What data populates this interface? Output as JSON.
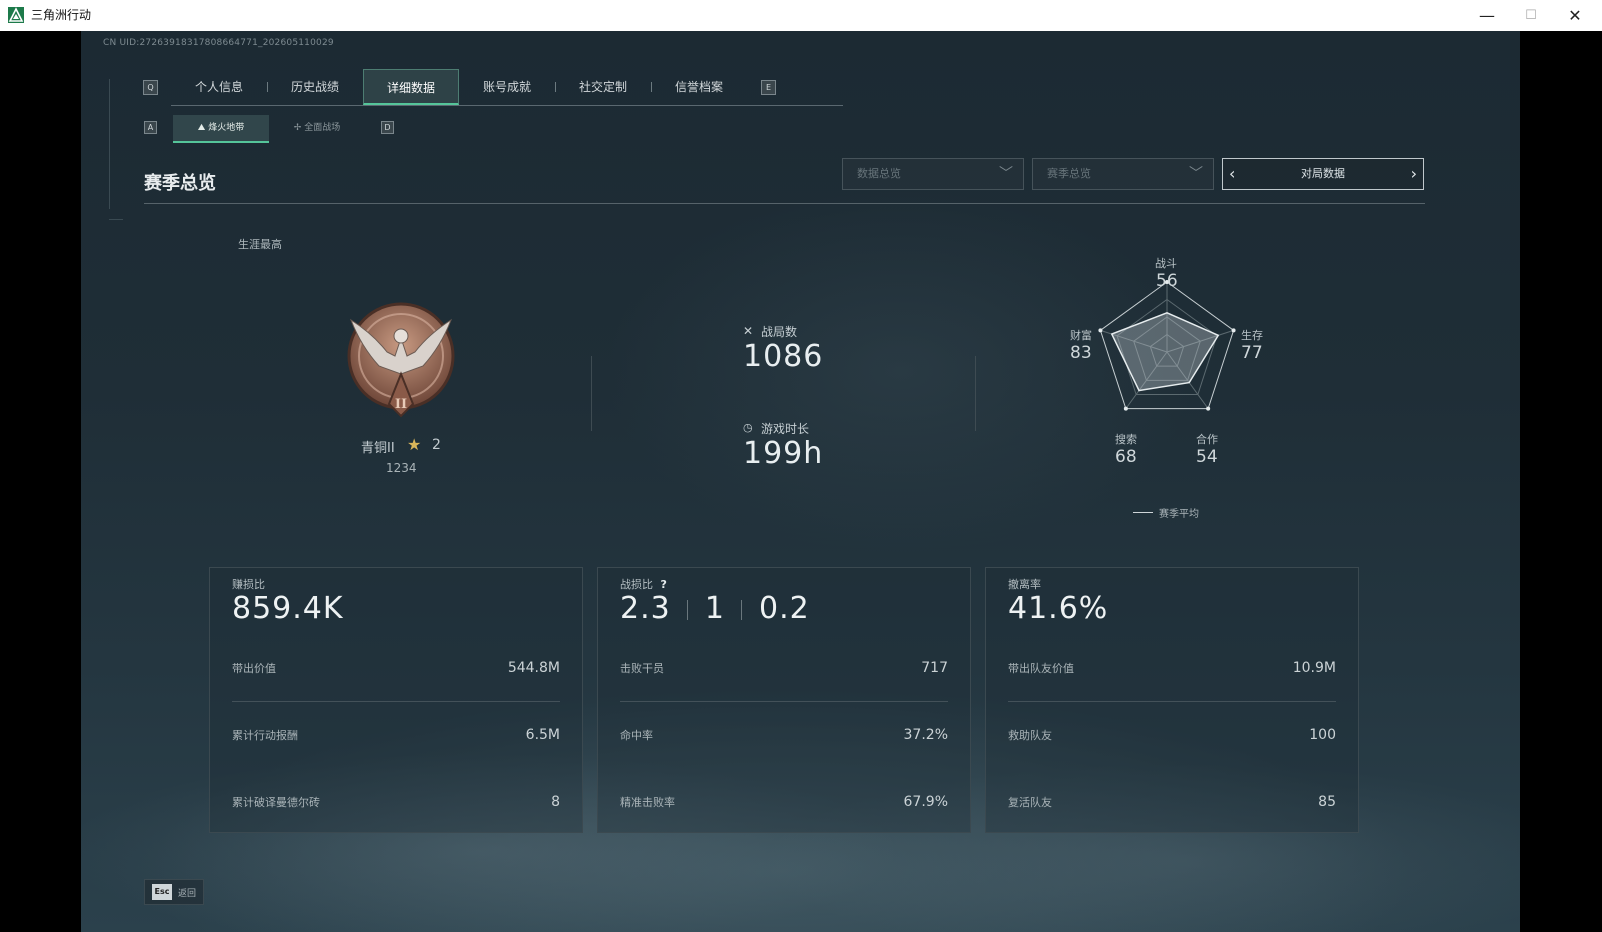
{
  "window": {
    "title": "三角洲行动",
    "minimize": "—",
    "maximize": "☐",
    "close": "✕"
  },
  "uid": "CN UID:27263918317808664771_202605110029",
  "nav": {
    "left_key": "Q",
    "right_key": "E",
    "tabs": [
      "个人信息",
      "历史战绩",
      "详细数据",
      "账号成就",
      "社交定制",
      "信誉档案"
    ],
    "active_tab": "详细数据"
  },
  "subnav": {
    "left_key": "A",
    "right_key": "D",
    "tabs": [
      "烽火地带",
      "全面战场"
    ],
    "active_tab": "烽火地带"
  },
  "section": {
    "title": "赛季总览"
  },
  "filters": {
    "dropdown1": "数据总览",
    "dropdown2": "赛季总览",
    "pager_label": "对局数据"
  },
  "rank": {
    "career_label": "生涯最高",
    "name": "青铜II",
    "stars": "2",
    "score": "1234",
    "badge_numeral": "II"
  },
  "stats": {
    "matches_label": "战局数",
    "matches_value": "1086",
    "playtime_label": "游戏时长",
    "playtime_value": "199h"
  },
  "radar": {
    "axes": [
      {
        "label": "战斗",
        "value": "56"
      },
      {
        "label": "生存",
        "value": "77"
      },
      {
        "label": "合作",
        "value": "54"
      },
      {
        "label": "搜索",
        "value": "68"
      },
      {
        "label": "财富",
        "value": "83"
      }
    ],
    "legend": "赛季平均"
  },
  "cards": [
    {
      "label": "赚损比",
      "value": "859.4K",
      "rows": [
        {
          "k": "带出价值",
          "v": "544.8M"
        },
        {
          "k": "累计行动报酬",
          "v": "6.5M"
        },
        {
          "k": "累计破译曼德尔砖",
          "v": "8"
        }
      ]
    },
    {
      "label": "战损比",
      "help": "?",
      "value_parts": [
        "2.3",
        "1",
        "0.2"
      ],
      "rows": [
        {
          "k": "击败干员",
          "v": "717"
        },
        {
          "k": "命中率",
          "v": "37.2%"
        },
        {
          "k": "精准击败率",
          "v": "67.9%"
        }
      ]
    },
    {
      "label": "撤离率",
      "value": "41.6%",
      "rows": [
        {
          "k": "带出队友价值",
          "v": "10.9M"
        },
        {
          "k": "救助队友",
          "v": "100"
        },
        {
          "k": "复活队友",
          "v": "85"
        }
      ]
    }
  ],
  "footer": {
    "esc_key": "Esc",
    "back_label": "返回"
  },
  "colors": {
    "accent": "#55c59a",
    "bg": "#1f2e37",
    "gold": "#d9b65a",
    "bronze": "#9a6a55"
  }
}
